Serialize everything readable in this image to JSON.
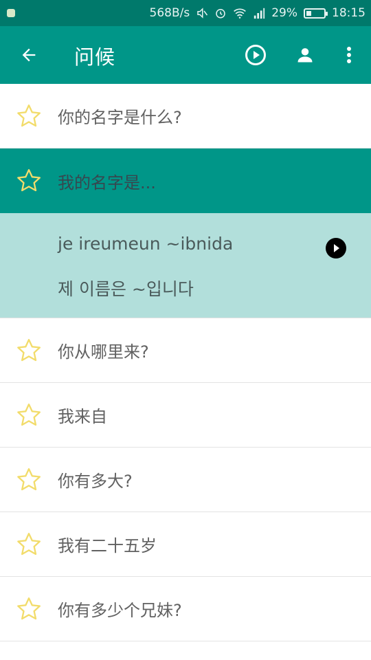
{
  "status_bar": {
    "speed": "568B/s",
    "battery": "29%",
    "battery_level": 0.29,
    "time": "18:15"
  },
  "app_bar": {
    "title": "问候",
    "icons": [
      "arrow-back-icon",
      "play-circle-icon",
      "person-icon",
      "more-vert-icon"
    ]
  },
  "colors": {
    "status_bar": "#00796b",
    "primary": "#009688",
    "expanded_bg": "#b2dfdb",
    "star_outline": "#f2dc6b"
  },
  "phrases": [
    {
      "text": "你的名字是什么?"
    },
    {
      "text": "我的名字是...",
      "selected": true
    },
    {
      "text": "你从哪里来?"
    },
    {
      "text": "我来自"
    },
    {
      "text": "你有多大?"
    },
    {
      "text": "我有二十五岁"
    },
    {
      "text": "你有多少个兄妹?"
    }
  ],
  "expanded": {
    "romanization": "je ireumeun ~ibnida",
    "korean": "제 이름은 ~입니다"
  }
}
